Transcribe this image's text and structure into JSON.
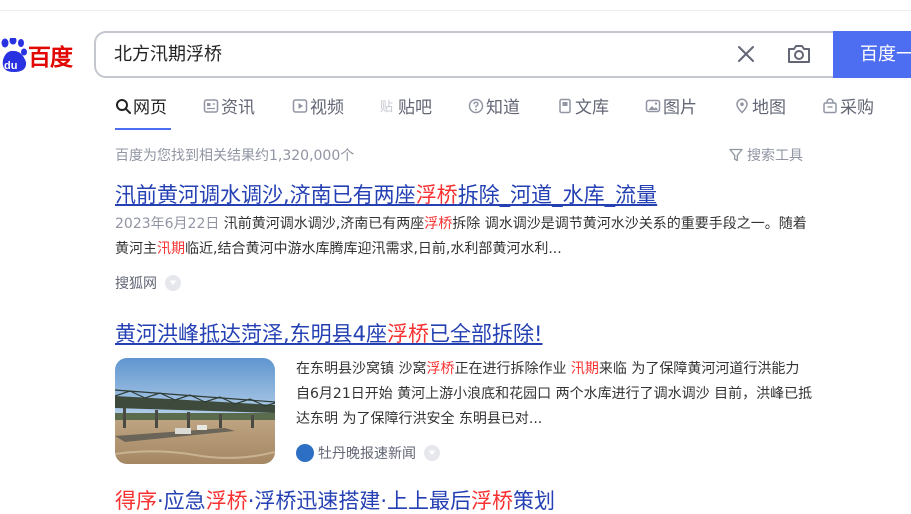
{
  "logo": {
    "text": "百度"
  },
  "search": {
    "query": "北方汛期浮桥",
    "button_label": "百度一"
  },
  "tabs": [
    {
      "label": "网页",
      "icon": "search-icon",
      "active": true
    },
    {
      "label": "资讯",
      "icon": "news-icon"
    },
    {
      "label": "视频",
      "icon": "video-icon"
    },
    {
      "label": "贴吧",
      "icon": "tieba-icon"
    },
    {
      "label": "知道",
      "icon": "question-icon"
    },
    {
      "label": "文库",
      "icon": "document-icon"
    },
    {
      "label": "图片",
      "icon": "image-icon"
    },
    {
      "label": "地图",
      "icon": "map-pin-icon"
    },
    {
      "label": "采购",
      "icon": "shopping-bag-icon"
    }
  ],
  "stats": "百度为您找到相关结果约1,320,000个",
  "tools_label": "搜索工具",
  "results": [
    {
      "title_parts": [
        "汛前黄河调水调沙,济南已有两座",
        "浮桥",
        "拆除_河道_水库_流量"
      ],
      "date": "2023年6月22日",
      "snippet_parts": [
        " 汛前黄河调水调沙,济南已有两座",
        "浮桥",
        "拆除 调水调沙是调节黄河水沙关系的重要手段之一。随着黄河主",
        "汛期",
        "临近,结合黄河中游水库腾库迎汛需求,日前,水利部黄河水利..."
      ],
      "source": "搜狐网"
    },
    {
      "title_parts": [
        "黄河洪峰抵达菏泽,东明县4座",
        "浮桥",
        "已全部拆除!"
      ],
      "snippet_parts": [
        "在东明县沙窝镇 沙窝",
        "浮桥",
        "正在进行拆除作业 ",
        "汛期",
        "来临 为了保障黄河河道行洪能力 自6月21日开始 黄河上游小浪底和花园口 两个水库进行了调水调沙 目前，洪峰已抵达东明 为了保障行洪安全 东明县已对..."
      ],
      "source": "牡丹晚报速新闻"
    }
  ],
  "partial_next": {
    "title_parts": [
      "得序",
      "·应急",
      "浮桥",
      "·浮桥迅速搭建·上上最后",
      "浮桥",
      "策划"
    ]
  },
  "colors": {
    "accent": "#4e6ef2",
    "link": "#2440b3",
    "highlight": "#f73131",
    "logo_red": "#e10601",
    "logo_blue": "#2932e1"
  }
}
